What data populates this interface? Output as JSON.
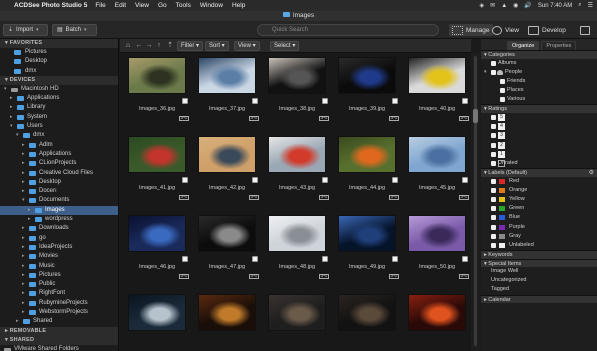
{
  "menubar": {
    "apple": "",
    "app_name": "ACDSee Photo Studio 5",
    "menus": [
      "File",
      "Edit",
      "View",
      "Go",
      "Tools",
      "Window",
      "Help"
    ],
    "status": [
      "◈",
      "✉",
      "▲",
      "◉",
      "🔊"
    ],
    "clock": "Sun 7:40 AM"
  },
  "window": {
    "title": "Images"
  },
  "toolbar": {
    "import_label": "Import",
    "batch_label": "Batch",
    "search_placeholder": "Quick Search",
    "modes": [
      "Manage",
      "View",
      "Develop"
    ]
  },
  "center_toolbar": {
    "filter": "Filter",
    "sort": "Sort",
    "view": "View",
    "select": "Select"
  },
  "left_panel": {
    "favorites_header": "FAVORITES",
    "favorites": [
      "Pictures",
      "Desktop",
      "dmx"
    ],
    "devices_header": "DEVICES",
    "tree": [
      {
        "label": "Macintosh HD",
        "depth": 1,
        "twisty": "▾",
        "icon": "hd"
      },
      {
        "label": "Applications",
        "depth": 2,
        "twisty": "▸",
        "icon": "folder"
      },
      {
        "label": "Library",
        "depth": 2,
        "twisty": "▸",
        "icon": "folder"
      },
      {
        "label": "System",
        "depth": 2,
        "twisty": "▸",
        "icon": "folder"
      },
      {
        "label": "Users",
        "depth": 2,
        "twisty": "▾",
        "icon": "folder"
      },
      {
        "label": "dmx",
        "depth": 3,
        "twisty": "▾",
        "icon": "folder"
      },
      {
        "label": "Adlm",
        "depth": 4,
        "twisty": "▸",
        "icon": "folder"
      },
      {
        "label": "Applications",
        "depth": 4,
        "twisty": "▸",
        "icon": "folder"
      },
      {
        "label": "CLionProjects",
        "depth": 4,
        "twisty": "▸",
        "icon": "folder"
      },
      {
        "label": "Creative Cloud Files",
        "depth": 4,
        "twisty": "▸",
        "icon": "folder"
      },
      {
        "label": "Desktop",
        "depth": 4,
        "twisty": "▸",
        "icon": "folder"
      },
      {
        "label": "Docerı",
        "depth": 4,
        "twisty": "▸",
        "icon": "folder"
      },
      {
        "label": "Documents",
        "depth": 4,
        "twisty": "▾",
        "icon": "folder"
      },
      {
        "label": "Images",
        "depth": 5,
        "twisty": "▸",
        "icon": "folder",
        "selected": true
      },
      {
        "label": "wordpress",
        "depth": 5,
        "twisty": "▸",
        "icon": "folder"
      },
      {
        "label": "Downloads",
        "depth": 4,
        "twisty": "▸",
        "icon": "folder"
      },
      {
        "label": "go",
        "depth": 4,
        "twisty": "▸",
        "icon": "folder"
      },
      {
        "label": "IdeaProjects",
        "depth": 4,
        "twisty": "▸",
        "icon": "folder"
      },
      {
        "label": "Movies",
        "depth": 4,
        "twisty": "▸",
        "icon": "folder"
      },
      {
        "label": "Music",
        "depth": 4,
        "twisty": "▸",
        "icon": "folder"
      },
      {
        "label": "Pictures",
        "depth": 4,
        "twisty": "▸",
        "icon": "folder"
      },
      {
        "label": "Public",
        "depth": 4,
        "twisty": "▸",
        "icon": "folder"
      },
      {
        "label": "RightFont",
        "depth": 4,
        "twisty": "▸",
        "icon": "folder"
      },
      {
        "label": "RubymineProjects",
        "depth": 4,
        "twisty": "▸",
        "icon": "folder"
      },
      {
        "label": "WebstormProjects",
        "depth": 4,
        "twisty": "▸",
        "icon": "folder"
      },
      {
        "label": "Shared",
        "depth": 3,
        "twisty": "▸",
        "icon": "folder"
      }
    ],
    "removable_header": "REMOVABLE",
    "shared_header": "SHARED",
    "shared": [
      "VMware Shared Folders"
    ]
  },
  "thumbnails": [
    {
      "name": "Images_36.jpg",
      "tag": "JPG",
      "colors": [
        "#6b7a4a",
        "#2d3320",
        "#a89a6a"
      ]
    },
    {
      "name": "Images_37.jpg",
      "tag": "JPG",
      "colors": [
        "#c9d6e4",
        "#5a7ea6",
        "#2c4766"
      ]
    },
    {
      "name": "Images_38.jpg",
      "tag": "JPG",
      "colors": [
        "#111111",
        "#555555",
        "#c9c2bb"
      ]
    },
    {
      "name": "Images_39.jpg",
      "tag": "JPG",
      "colors": [
        "#0b0b0b",
        "#1f3a8a",
        "#2a2a2a"
      ]
    },
    {
      "name": "Images_40.jpg",
      "tag": "JPG",
      "colors": [
        "#d9d9d9",
        "#e3c21a",
        "#222222"
      ]
    },
    {
      "name": "Images_41.jpg",
      "tag": "JPG",
      "colors": [
        "#3a5a2a",
        "#c2342c",
        "#2b4a22"
      ]
    },
    {
      "name": "Images_42.jpg",
      "tag": "JPG",
      "colors": [
        "#cfa06a",
        "#3a4a5a",
        "#d8b07a"
      ]
    },
    {
      "name": "Images_43.jpg",
      "tag": "JPG",
      "colors": [
        "#9aa7b4",
        "#d23a2a",
        "#e6e6e6"
      ]
    },
    {
      "name": "Images_44.jpg",
      "tag": "JPG",
      "colors": [
        "#58702e",
        "#e0681e",
        "#3a4a1e"
      ]
    },
    {
      "name": "Images_45.jpg",
      "tag": "JPG",
      "colors": [
        "#7fa6d0",
        "#4a6fa0",
        "#b8cde2"
      ]
    },
    {
      "name": "Images_46.jpg",
      "tag": "JPG",
      "colors": [
        "#1a2a5a",
        "#3a6ac0",
        "#0a1030"
      ]
    },
    {
      "name": "Images_47.jpg",
      "tag": "JPG",
      "colors": [
        "#0c0c0c",
        "#8a8a8a",
        "#2a2a2a"
      ]
    },
    {
      "name": "Images_48.jpg",
      "tag": "JPG",
      "colors": [
        "#cfd4da",
        "#8a8f96",
        "#eef0f2"
      ]
    },
    {
      "name": "Images_49.jpg",
      "tag": "JPG",
      "colors": [
        "#06142a",
        "#1f3f7a",
        "#3a68b8"
      ]
    },
    {
      "name": "Images_50.jpg",
      "tag": "JPG",
      "colors": [
        "#7a5aa8",
        "#3a2a5a",
        "#b79ad8"
      ]
    },
    {
      "name": "",
      "tag": "",
      "colors": [
        "#1a2a3a",
        "#b6c2cc",
        "#0a141e"
      ]
    },
    {
      "name": "",
      "tag": "",
      "colors": [
        "#1a0e08",
        "#c07a2a",
        "#5a2a10"
      ]
    },
    {
      "name": "",
      "tag": "",
      "colors": [
        "#1e1e1e",
        "#6a5a4a",
        "#3a3230"
      ]
    },
    {
      "name": "",
      "tag": "",
      "colors": [
        "#121212",
        "#5a4a3a",
        "#2a2420"
      ]
    },
    {
      "name": "",
      "tag": "",
      "colors": [
        "#2a0a08",
        "#e0521e",
        "#8a1f10"
      ]
    }
  ],
  "right_panel": {
    "tabs": [
      "Organize",
      "Properties"
    ],
    "categories_header": "Categories",
    "categories": [
      {
        "label": "Albums",
        "indent": 1,
        "twisty": "",
        "icon": "cb"
      },
      {
        "label": "People",
        "indent": 1,
        "twisty": "▾",
        "icon": "cb"
      },
      {
        "label": "Friends",
        "indent": 2,
        "twisty": "",
        "icon": "cb"
      },
      {
        "label": "Places",
        "indent": 2,
        "twisty": "",
        "icon": "cb"
      },
      {
        "label": "Various",
        "indent": 2,
        "twisty": "",
        "icon": "cb"
      }
    ],
    "ratings_header": "Ratings",
    "ratings": [
      "1",
      "2",
      "3",
      "4",
      "5",
      "Unrated"
    ],
    "ratings_nums": [
      "5",
      "4",
      "3",
      "2",
      "1",
      ""
    ],
    "labels_header": "Labels (Default)",
    "labels": [
      {
        "name": "Red",
        "color": "#d62a2a"
      },
      {
        "name": "Orange",
        "color": "#e07a1e"
      },
      {
        "name": "Yellow",
        "color": "#e3c21a"
      },
      {
        "name": "Green",
        "color": "#2ca42c"
      },
      {
        "name": "Blue",
        "color": "#2a5ad6"
      },
      {
        "name": "Purple",
        "color": "#7a2ab0"
      },
      {
        "name": "Gray",
        "color": "#8a8a8a"
      },
      {
        "name": "Unlabeled",
        "color": "#f0f0f0"
      }
    ],
    "keywords_header": "Keywords",
    "special_header": "Special Items",
    "special": [
      "Image Well",
      "Uncategorized",
      "Tagged"
    ],
    "calendar_header": "Calendar"
  }
}
